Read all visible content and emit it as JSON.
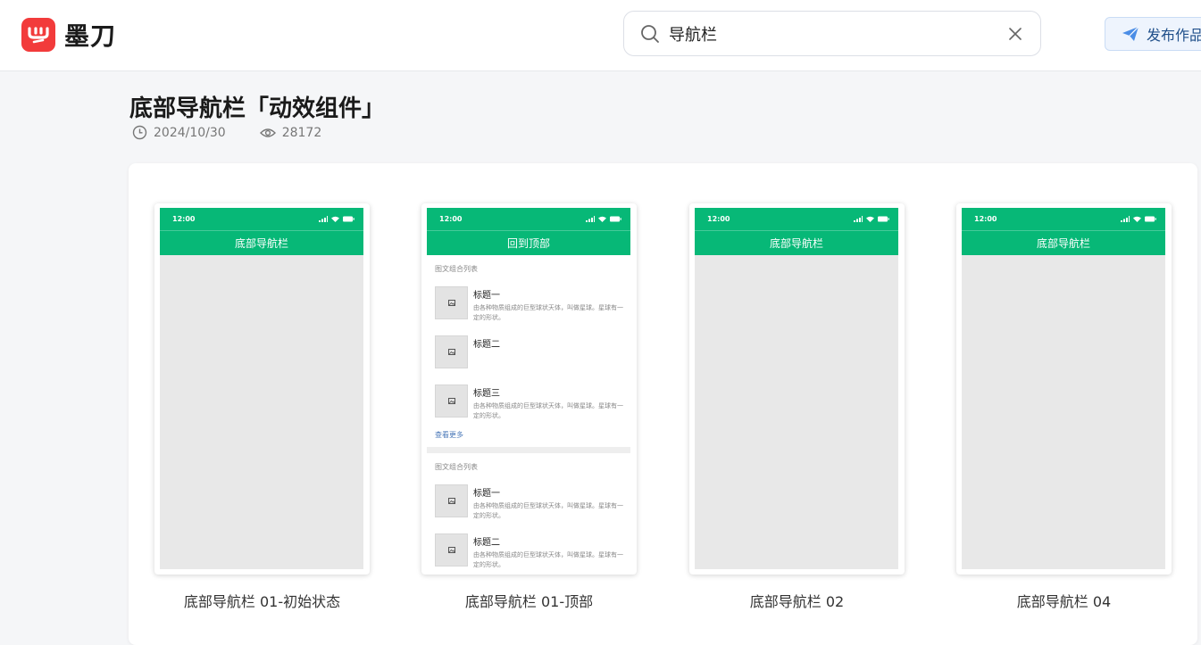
{
  "app": {
    "name": "墨刀"
  },
  "search": {
    "value": "导航栏"
  },
  "header": {
    "publish_label": "发布作品"
  },
  "page": {
    "title": "底部导航栏「动效组件」",
    "date": "2024/10/30",
    "views": "28172"
  },
  "colors": {
    "brand_red": "#f23b3b",
    "nav_green": "#07b877"
  },
  "screens": [
    {
      "time": "12:00",
      "nav_title": "底部导航栏",
      "caption": "底部导航栏 01-初始状态"
    },
    {
      "time": "12:00",
      "nav_title": "回到顶部",
      "caption": "底部导航栏 01-顶部",
      "list": {
        "section1_label": "图文组合列表",
        "items1": [
          {
            "title": "标题一",
            "desc": "由各种物质组成的巨型球状天体，叫做星球。星球有一定的形状。"
          },
          {
            "title": "标题二",
            "desc": ""
          },
          {
            "title": "标题三",
            "desc": "由各种物质组成的巨型球状天体，叫做星球。星球有一定的形状。"
          }
        ],
        "more_label": "查看更多",
        "section2_label": "图文组合列表",
        "items2": [
          {
            "title": "标题一",
            "desc": "由各种物质组成的巨型球状天体，叫做星球。星球有一定的形状。"
          },
          {
            "title": "标题二",
            "desc": "由各种物质组成的巨型球状天体，叫做星球。星球有一定的形状。"
          }
        ]
      }
    },
    {
      "time": "12:00",
      "nav_title": "底部导航栏",
      "caption": "底部导航栏 02"
    },
    {
      "time": "12:00",
      "nav_title": "底部导航栏",
      "caption": "底部导航栏 04"
    }
  ]
}
